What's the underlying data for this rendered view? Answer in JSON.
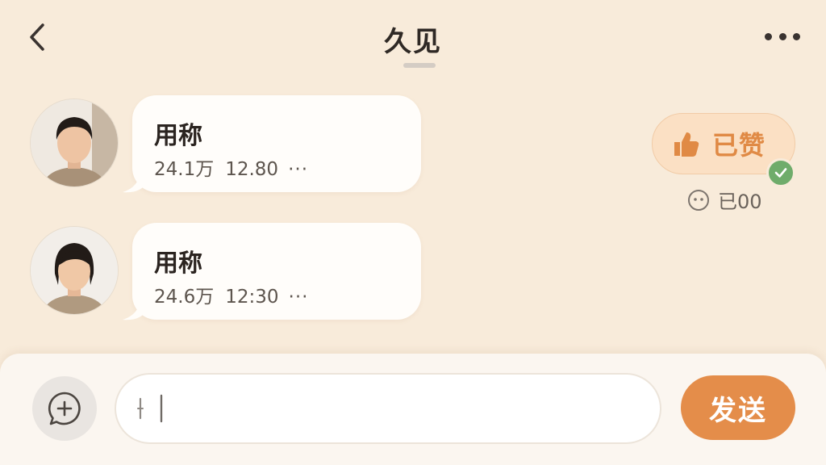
{
  "header": {
    "title": "久见",
    "back_icon": "chevron-left-icon",
    "more_icon": "more-horizontal-icon"
  },
  "messages": [
    {
      "name": "用称",
      "count": "24.1万",
      "time": "12.80",
      "more": "···"
    },
    {
      "name": "用称",
      "count": "24.6万",
      "time": "12:30",
      "more": "···"
    }
  ],
  "like_badge": {
    "label": "已赞",
    "icon": "thumbs-up-icon",
    "check_icon": "check-icon",
    "count_icon": "smile-icon",
    "count_text": "已00"
  },
  "composer": {
    "add_icon": "add-chat-icon",
    "input_value": "",
    "input_placeholder": "",
    "send_label": "发送"
  },
  "colors": {
    "background": "#f8ebda",
    "accent": "#e48d4a",
    "badge_bg": "#fbe0c4",
    "check": "#6fac6b"
  }
}
